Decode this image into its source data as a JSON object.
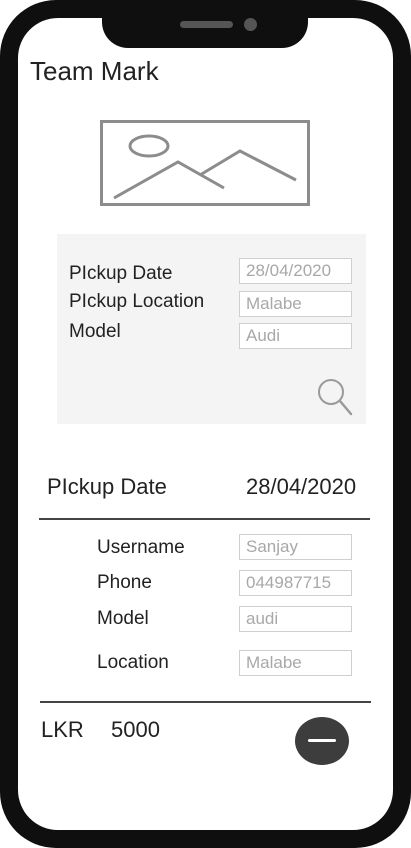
{
  "app": {
    "title": "Team Mark"
  },
  "search_panel": {
    "rows": [
      {
        "label": "PIckup Date",
        "value": "28/04/2020"
      },
      {
        "label": "PIckup Location",
        "value": "Malabe"
      },
      {
        "label": "Model",
        "value": "Audi"
      }
    ],
    "search_icon": "search-icon"
  },
  "booking": {
    "pickup_label": "PIckup Date",
    "pickup_value": "28/04/2020",
    "fields": [
      {
        "label": "Username",
        "value": "Sanjay"
      },
      {
        "label": "Phone",
        "value": "044987715"
      },
      {
        "label": "Model",
        "value": "audi"
      },
      {
        "label": "Location",
        "value": "Malabe"
      }
    ]
  },
  "price": {
    "currency": "LKR",
    "amount": "5000"
  },
  "actions": {
    "remove_icon": "minus-icon"
  },
  "colors": {
    "frame": "#0f0f0f",
    "panel": "#f4f4f4",
    "fab": "#3d3d3d"
  }
}
